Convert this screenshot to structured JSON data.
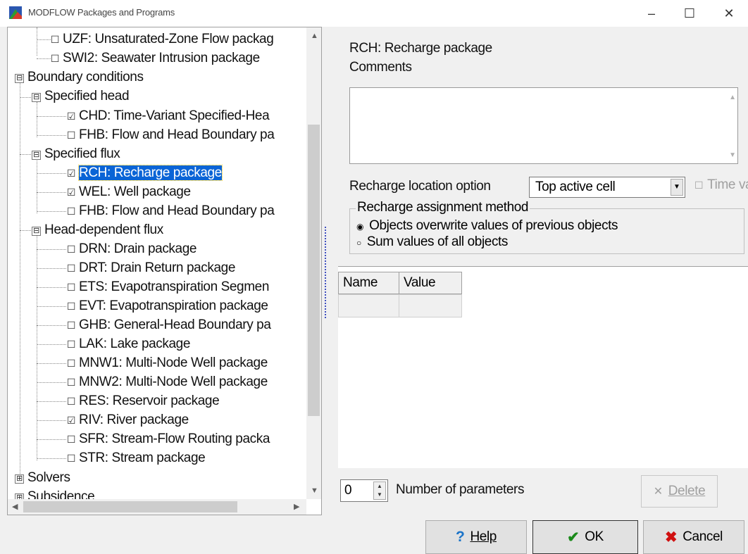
{
  "window": {
    "title": "MODFLOW Packages and Programs",
    "minimize_glyph": "–",
    "maximize_glyph": "☐",
    "close_glyph": "✕",
    "icon": "app-icon"
  },
  "tree": {
    "items": [
      {
        "text": "UZF: Unsaturated-Zone Flow packag",
        "checked": false
      },
      {
        "text": "SWI2: Seawater Intrusion package",
        "checked": false
      },
      {
        "text": "Boundary conditions",
        "expander": "⊟"
      },
      {
        "text": "Specified head",
        "expander": "⊟"
      },
      {
        "text": "CHD: Time-Variant Specified-Hea",
        "checked": true
      },
      {
        "text": "FHB: Flow and Head Boundary pa",
        "checked": false
      },
      {
        "text": "Specified flux",
        "expander": "⊟"
      },
      {
        "text": "RCH: Recharge package",
        "checked": true,
        "selected": true
      },
      {
        "text": "WEL: Well package",
        "checked": true
      },
      {
        "text": "FHB: Flow and Head Boundary pa",
        "checked": false
      },
      {
        "text": "Head-dependent flux",
        "expander": "⊟"
      },
      {
        "text": "DRN: Drain package",
        "checked": false
      },
      {
        "text": "DRT: Drain Return package",
        "checked": false
      },
      {
        "text": "ETS: Evapotranspiration Segmen",
        "checked": false
      },
      {
        "text": "EVT: Evapotranspiration package",
        "checked": false
      },
      {
        "text": "GHB: General-Head Boundary pa",
        "checked": false
      },
      {
        "text": "LAK: Lake package",
        "checked": false
      },
      {
        "text": "MNW1: Multi-Node Well package",
        "checked": false
      },
      {
        "text": "MNW2: Multi-Node Well package",
        "checked": false
      },
      {
        "text": "RES: Reservoir package",
        "checked": false
      },
      {
        "text": "RIV: River package",
        "checked": true
      },
      {
        "text": "SFR: Stream-Flow Routing packa",
        "checked": false
      },
      {
        "text": "STR: Stream package",
        "checked": false
      },
      {
        "text": "Solvers",
        "expander": "⊞"
      },
      {
        "text": "Subsidence",
        "expander": "⊞"
      }
    ]
  },
  "details": {
    "package_title": "RCH: Recharge package",
    "comments_label": "Comments",
    "comments_value": "",
    "location_label": "Recharge location option",
    "location_value": "Top active cell",
    "time_varying_label": "Time var",
    "assignment_legend": "Recharge assignment method",
    "radio_overwrite": "Objects overwrite values of previous objects",
    "radio_sum": "Sum values of all objects"
  },
  "grid": {
    "col_name": "Name",
    "col_value": "Value"
  },
  "params": {
    "count": "0",
    "label": "Number of parameters",
    "delete_label": "Delete"
  },
  "buttons": {
    "help": "Help",
    "ok": "OK",
    "cancel": "Cancel"
  },
  "colors": {
    "selection": "#0a64d6",
    "help_icon": "#1a73c8",
    "ok_icon": "#1a8a1a",
    "cancel_icon": "#d01010"
  }
}
